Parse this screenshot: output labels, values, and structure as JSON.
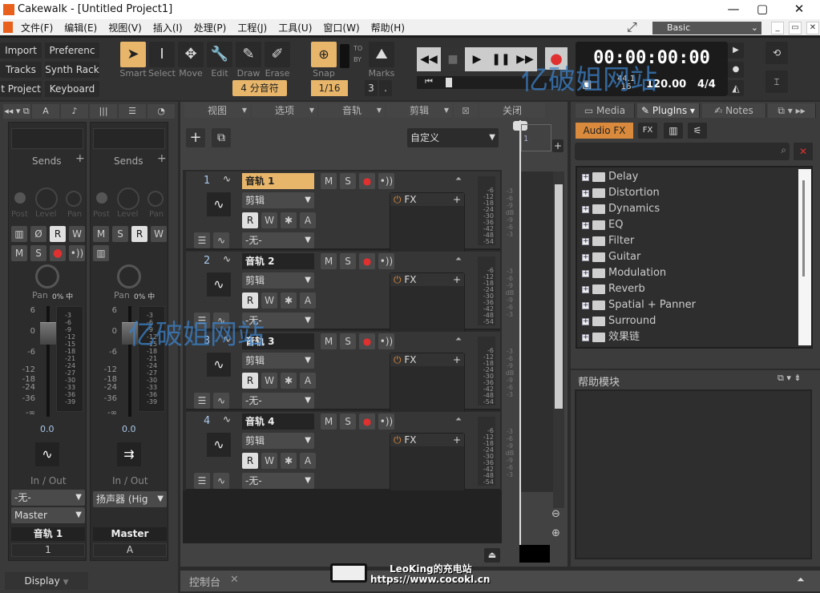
{
  "window": {
    "title": "Cakewalk - [Untitled Project1]",
    "minimize": "—",
    "maximize": "▢",
    "close": "✕"
  },
  "menu": [
    "文件(F)",
    "编辑(E)",
    "视图(V)",
    "插入(I)",
    "处理(P)",
    "工程(J)",
    "工具(U)",
    "窗口(W)",
    "帮助(H)"
  ],
  "workspace": {
    "label": "Basic",
    "mdi": [
      "_",
      "▭",
      "✕"
    ]
  },
  "toolbar": {
    "left_buttons": [
      "Import",
      "Preferenc ...",
      "Tracks",
      "Synth Rack",
      "t Project",
      "Keyboard"
    ],
    "tools": [
      {
        "label": "Smart",
        "glyph": "➤"
      },
      {
        "label": "Select",
        "glyph": "I"
      },
      {
        "label": "Move",
        "glyph": "✥"
      },
      {
        "label": "Edit",
        "glyph": "🔧"
      },
      {
        "label": "Draw",
        "glyph": "✎"
      },
      {
        "label": "Erase",
        "glyph": "✐"
      }
    ],
    "note_value": "4 分音符",
    "snap_label": "Snap",
    "snap_to": "TO",
    "snap_by": "BY",
    "marks_label": "Marks",
    "snap_value": "1/16",
    "snap_num": "3",
    "snap_dot": ".",
    "transport": [
      "◀◀",
      "■",
      "▶",
      "❚❚",
      "▶▶"
    ],
    "clock": {
      "time": "00:00:00:00",
      "sample_rate": "44.1",
      "bit_depth": "16",
      "tempo": "120.00",
      "meter": "4/4"
    }
  },
  "mixer": {
    "tabs": [
      "◂◂ ▾ ⧉",
      "A",
      "♪",
      "|||",
      "☰",
      "◔"
    ],
    "sends_label": "Sends",
    "post": "Post",
    "level": "Level",
    "pan_small": "Pan",
    "strips": [
      {
        "name": "音轨 1",
        "number": "1",
        "pan_label": "Pan",
        "pan_value": "0% 中",
        "volume": "0.0",
        "in": "-无-",
        "out": "Master",
        "io_label": "In / Out"
      },
      {
        "name": "Master",
        "number": "A",
        "pan_label": "Pan",
        "pan_value": "0% 中",
        "volume": "0.0",
        "out": "扬声器 (Hig",
        "io_label": "In / Out"
      }
    ],
    "scale": [
      "6",
      "0",
      "-6",
      "-12",
      "-18",
      "-24",
      "-36",
      "-∞"
    ],
    "meter_scale": [
      "-3",
      "-6",
      "-9",
      "-12",
      "-15",
      "-18",
      "-21",
      "-24",
      "-27",
      "-30",
      "-33",
      "-36",
      "-39"
    ],
    "display": "Display"
  },
  "trackview": {
    "menus": [
      "视图",
      "选项",
      "音轨",
      "剪辑"
    ],
    "close_label": "关闭",
    "preset": "自定义",
    "marker": "1",
    "tracks": [
      {
        "num": "1",
        "name": "音轨 1",
        "clip": "剪辑",
        "input": "-无-",
        "fx": "FX"
      },
      {
        "num": "2",
        "name": "音轨 2",
        "clip": "剪辑",
        "input": "-无-",
        "fx": "FX"
      },
      {
        "num": "3",
        "name": "音轨 3",
        "clip": "剪辑",
        "input": "-无-",
        "fx": "FX"
      },
      {
        "num": "4",
        "name": "音轨 4",
        "clip": "剪辑",
        "input": "-无-",
        "fx": "FX"
      }
    ],
    "meter_scale": [
      "-6",
      "-12",
      "-18",
      "-24",
      "-30",
      "-36",
      "-42",
      "-48",
      "-54"
    ],
    "db_scale": [
      "-3",
      "-6",
      "-9",
      "dB",
      "-9",
      "-6",
      "-3"
    ]
  },
  "browser": {
    "tabs": [
      "Media",
      "PlugIns",
      "Notes"
    ],
    "audio_fx": "Audio FX",
    "search_placeholder": "",
    "items": [
      "Delay",
      "Distortion",
      "Dynamics",
      "EQ",
      "Filter",
      "Guitar",
      "Modulation",
      "Reverb",
      "Spatial + Panner",
      "Surround",
      "效果链"
    ],
    "help_title": "帮助模块"
  },
  "console": {
    "label": "控制台",
    "close": "✕"
  },
  "watermark": {
    "text1": "亿破姐网站",
    "site_name": "LeoKing的充电站",
    "site_url": "https://www.cocokl.cn"
  }
}
